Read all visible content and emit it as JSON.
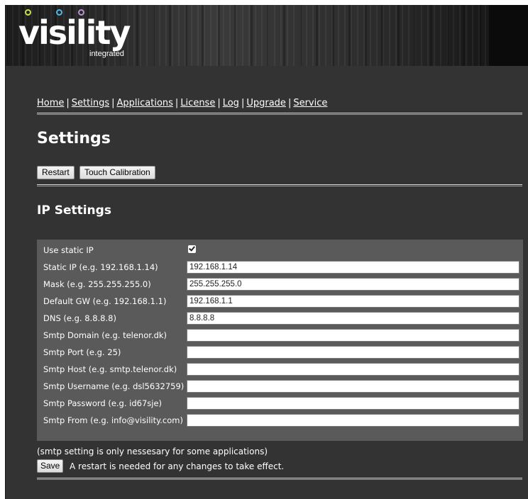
{
  "logo": {
    "text": "visility",
    "sub": "integrated",
    "dot_colors": [
      "#c9e04a",
      "#4fb8e8",
      "#b993d6"
    ]
  },
  "nav": {
    "items": [
      {
        "label": "Home"
      },
      {
        "label": "Settings"
      },
      {
        "label": "Applications"
      },
      {
        "label": "License"
      },
      {
        "label": "Log"
      },
      {
        "label": "Upgrade"
      },
      {
        "label": "Service"
      }
    ],
    "separator": "|"
  },
  "page": {
    "title": "Settings"
  },
  "actions": {
    "restart_label": "Restart",
    "touch_label": "Touch Calibration"
  },
  "ip_settings": {
    "title": "IP Settings",
    "use_static_label": "Use static IP",
    "use_static_checked": true,
    "fields": [
      {
        "label": "Static IP (e.g. 192.168.1.14)",
        "value": "192.168.1.14"
      },
      {
        "label": "Mask (e.g. 255.255.255.0)",
        "value": "255.255.255.0"
      },
      {
        "label": "Default GW (e.g. 192.168.1.1)",
        "value": "192.168.1.1"
      },
      {
        "label": "DNS (e.g. 8.8.8.8)",
        "value": "8.8.8.8"
      },
      {
        "label": "Smtp Domain (e.g. telenor.dk)",
        "value": ""
      },
      {
        "label": "Smtp Port (e.g. 25)",
        "value": ""
      },
      {
        "label": "Smtp Host (e.g. smtp.telenor.dk)",
        "value": ""
      },
      {
        "label": "Smtp Username (e.g. dsl5632759)",
        "value": ""
      },
      {
        "label": "Smtp Password (e.g. id67sje)",
        "value": ""
      },
      {
        "label": "Smtp From (e.g. info@visility.com)",
        "value": ""
      }
    ],
    "note": "(smtp setting is only nessesary for some applications)",
    "save_label": "Save",
    "save_note": "A restart is needed for any changes to take effect."
  },
  "colors": {
    "background": "#333333",
    "panel": "#5a5a5a",
    "text": "#ffffff"
  }
}
